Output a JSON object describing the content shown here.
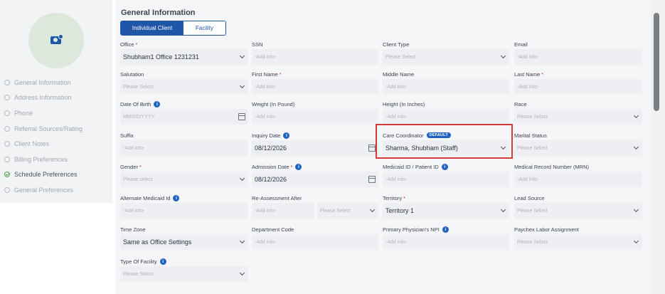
{
  "sidebar": {
    "items": [
      {
        "label": "General Information",
        "done": false
      },
      {
        "label": "Address Information",
        "done": false
      },
      {
        "label": "Phone",
        "done": false
      },
      {
        "label": "Referral Sources/Rating",
        "done": false
      },
      {
        "label": "Client Notes",
        "done": false
      },
      {
        "label": "Billing Preferences",
        "done": false
      },
      {
        "label": "Schedule Preferences",
        "done": true
      },
      {
        "label": "General Preferences",
        "done": false
      }
    ]
  },
  "main": {
    "title": "General Information",
    "toggle": {
      "active": "Individual Client",
      "inactive": "Facility"
    }
  },
  "fields": {
    "office": {
      "label": "Office",
      "value": "Shubham1 Office 1231231"
    },
    "ssn": {
      "label": "SSN",
      "placeholder": "-Add info-"
    },
    "client_type": {
      "label": "Client Type",
      "placeholder": "Please Select"
    },
    "email": {
      "label": "Email",
      "placeholder": "-Add info-"
    },
    "salutation": {
      "label": "Salutation",
      "placeholder": "Please Select"
    },
    "first_name": {
      "label": "First Name",
      "placeholder": "-Add info-"
    },
    "middle_name": {
      "label": "Middle Name",
      "placeholder": "-Add info-"
    },
    "last_name": {
      "label": "Last Name",
      "placeholder": "-Add info-"
    },
    "dob": {
      "label": "Date Of Birth",
      "placeholder": "MM/DD/YYYY"
    },
    "weight": {
      "label": "Weight (In Pound)",
      "placeholder": "-Add info-"
    },
    "height": {
      "label": "Height (In Inches)",
      "placeholder": "-Add info-"
    },
    "race": {
      "label": "Race",
      "placeholder": "Please Select"
    },
    "suffix": {
      "label": "Suffix",
      "placeholder": "-Add info-"
    },
    "inquiry_date": {
      "label": "Inquiry Date",
      "value": "08/12/2026"
    },
    "care_coordinator": {
      "label": "Care Coordinator",
      "badge": "DEFAULT",
      "value": "Sharma, Shubham (Staff)"
    },
    "marital_status": {
      "label": "Marital Status",
      "placeholder": "Please Select"
    },
    "gender": {
      "label": "Gender",
      "placeholder": "Please select"
    },
    "admission_date": {
      "label": "Admission Date",
      "value": "08/12/2026"
    },
    "medicaid_id": {
      "label": "Medicaid ID / Patient ID",
      "placeholder": "-Add info-"
    },
    "mrn": {
      "label": "Medical Record Number (MRN)",
      "placeholder": "-Add info-"
    },
    "alt_medicaid": {
      "label": "Alternate Medicaid Id",
      "placeholder": "-Add info-"
    },
    "reassessment": {
      "label": "Re-Assessment After",
      "placeholder": "-Add info-",
      "select_placeholder": "Please Select"
    },
    "territory": {
      "label": "Territory",
      "value": "Territory 1"
    },
    "lead_source": {
      "label": "Lead Source",
      "placeholder": "Please Select"
    },
    "time_zone": {
      "label": "Time Zone",
      "value": "Same as Office Settings"
    },
    "department_code": {
      "label": "Department Code",
      "placeholder": "-Add info-"
    },
    "physician_npi": {
      "label": "Primary Physician's NPI",
      "placeholder": "-Add info-"
    },
    "paychex": {
      "label": "Paychex Labor Assignment",
      "placeholder": "Please Select"
    },
    "type_of_facility": {
      "label": "Type Of Facility",
      "placeholder": "Please Select"
    }
  },
  "colors": {
    "primary": "#1f56a8",
    "highlight": "#d63a3a",
    "field_bg": "#edeff2"
  },
  "icons": {
    "info": "info-icon",
    "calendar": "calendar-icon",
    "chevron": "chevron-down-icon",
    "camera": "camera-icon"
  }
}
